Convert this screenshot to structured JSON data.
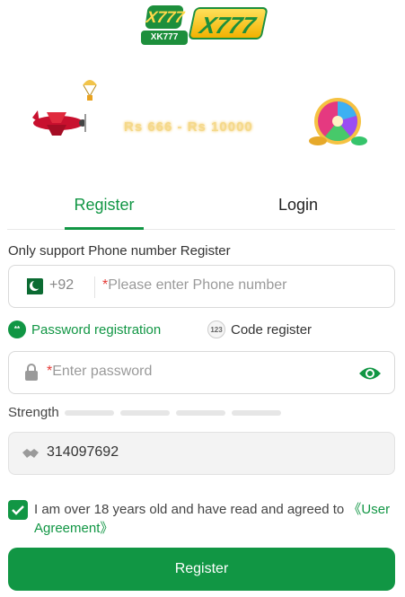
{
  "logo": {
    "small_text": "X777",
    "small_tag": "XK777",
    "big_text": "X777"
  },
  "banner": {
    "text": "Rs 666 - Rs 10000"
  },
  "tabs": {
    "register": "Register",
    "login": "Login"
  },
  "hint": "Only support Phone number Register",
  "phone": {
    "country_code": "+92",
    "required_mark": "*",
    "placeholder": "Please enter Phone number"
  },
  "modes": {
    "password": "Password registration",
    "password_badge": "**",
    "code": "Code register",
    "code_badge": "123"
  },
  "password": {
    "required_mark": "*",
    "placeholder": "Enter password"
  },
  "strength": {
    "label": "Strength"
  },
  "invite": {
    "value": "314097692"
  },
  "agreement": {
    "text": "I am over 18 years old and have read and agreed to ",
    "link": "《User Agreement》"
  },
  "submit": {
    "label": "Register"
  },
  "colors": {
    "accent": "#119644",
    "required": "#e53935"
  }
}
